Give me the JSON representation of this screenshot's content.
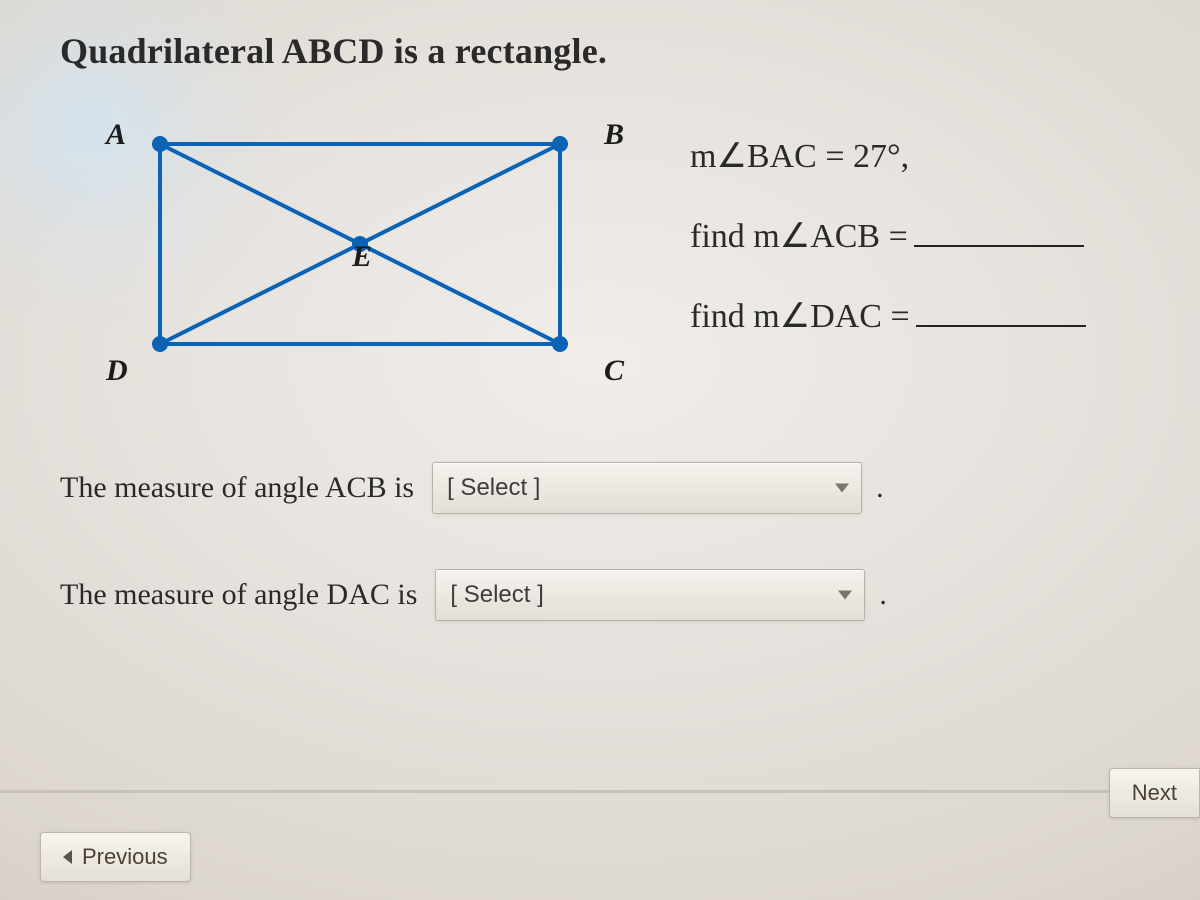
{
  "title": "Quadrilateral ABCD is a rectangle.",
  "figure": {
    "vertices": {
      "A": "A",
      "B": "B",
      "C": "C",
      "D": "D",
      "E": "E"
    }
  },
  "given": {
    "line1": "m∠BAC = 27°,",
    "line2_prefix": "find m∠ACB = ",
    "line3_prefix": "find m∠DAC = "
  },
  "questions": {
    "q1_prompt": "The measure of angle ACB is",
    "q1_select": "[ Select ]",
    "q2_prompt": "The measure of angle DAC is",
    "q2_select": "[ Select ]",
    "period": "."
  },
  "nav": {
    "previous": "Previous",
    "next": "Next"
  }
}
